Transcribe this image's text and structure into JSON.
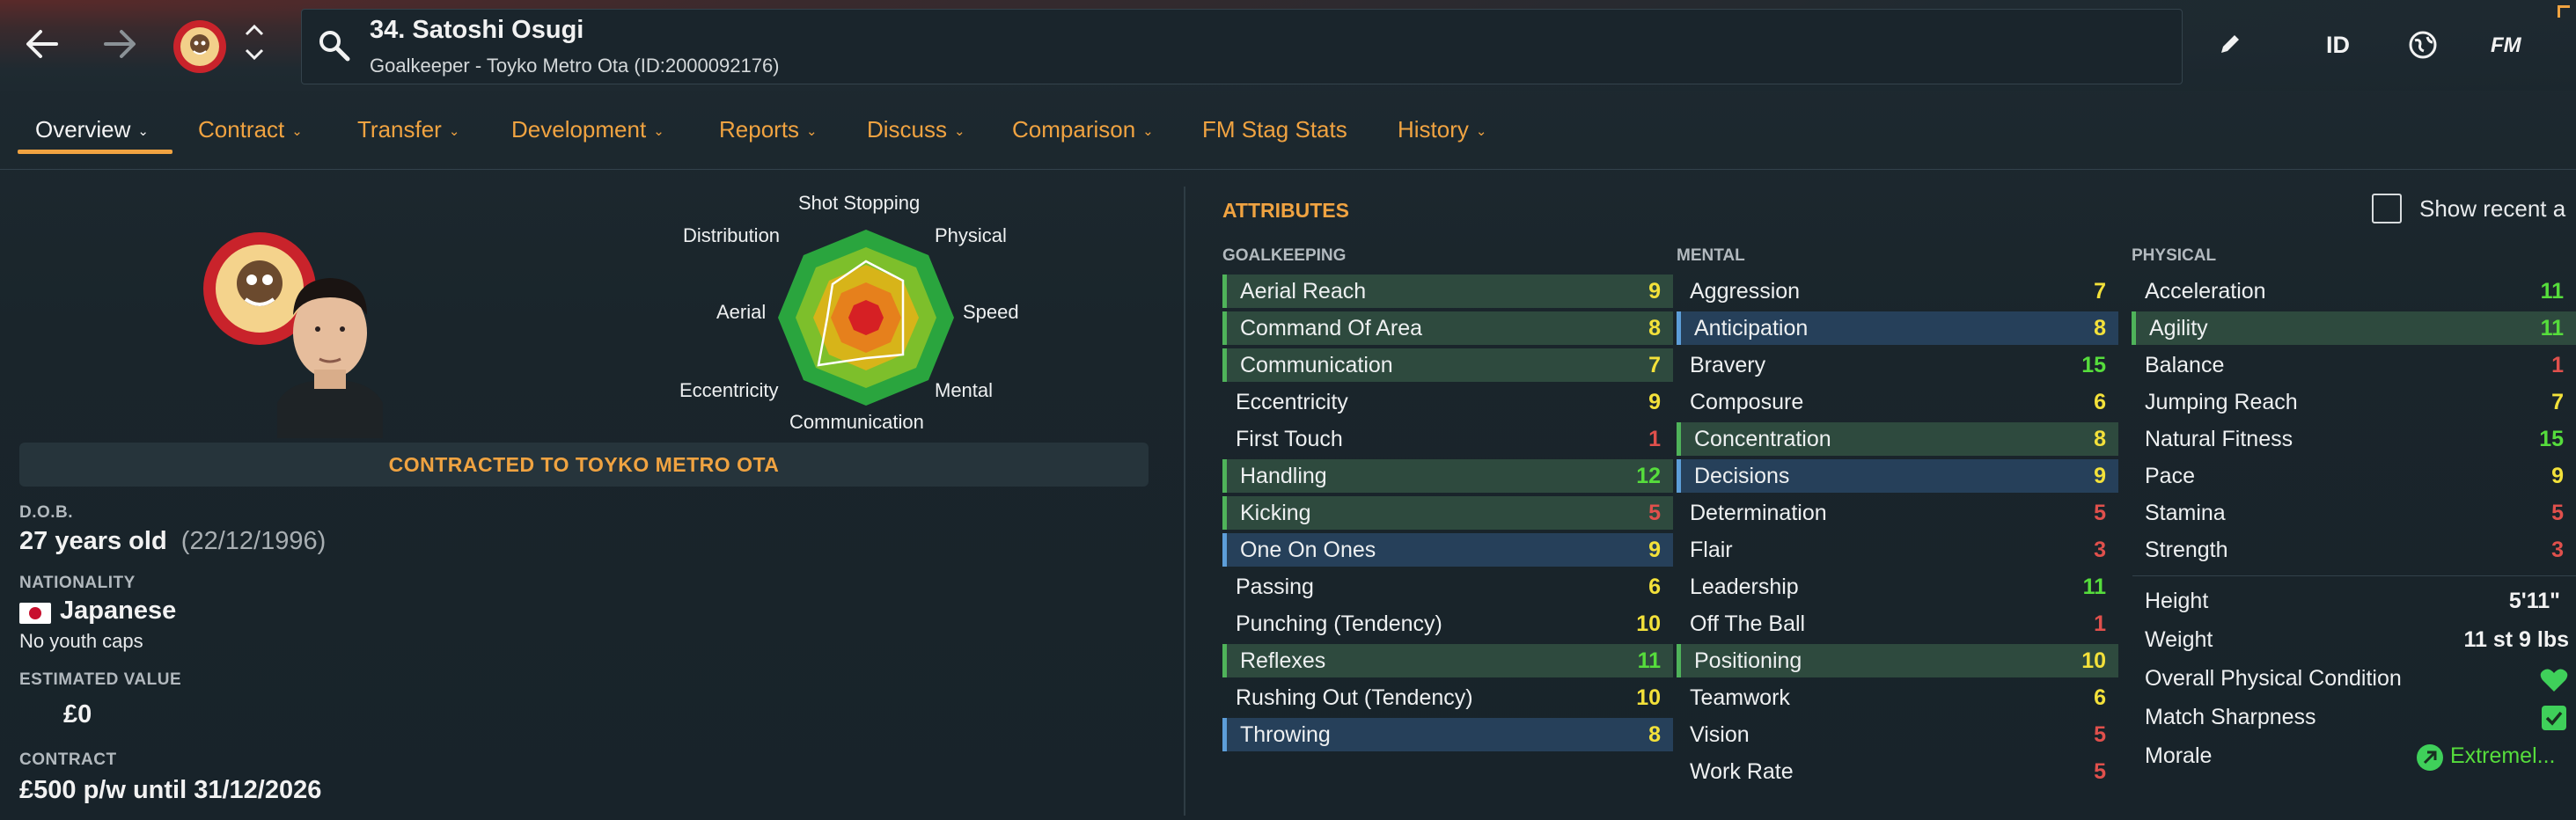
{
  "header": {
    "player_name": "34. Satoshi Osugi",
    "player_sub": "Goalkeeper - Toyko Metro Ota (ID:2000092176)",
    "id_label": "ID",
    "fm_label": "FM"
  },
  "tabs": [
    {
      "label": "Overview",
      "has_menu": true
    },
    {
      "label": "Contract",
      "has_menu": true
    },
    {
      "label": "Transfer",
      "has_menu": true
    },
    {
      "label": "Development",
      "has_menu": true
    },
    {
      "label": "Reports",
      "has_menu": true
    },
    {
      "label": "Discuss",
      "has_menu": true
    },
    {
      "label": "Comparison",
      "has_menu": true
    },
    {
      "label": "FM Stag Stats",
      "has_menu": false
    },
    {
      "label": "History",
      "has_menu": true
    }
  ],
  "radar": {
    "labels": [
      "Shot Stopping",
      "Physical",
      "Speed",
      "Mental",
      "Communication",
      "Eccentricity",
      "Aerial",
      "Distribution"
    ]
  },
  "profile": {
    "contract_banner": "CONTRACTED TO TOYKO METRO OTA",
    "dob_label": "D.O.B.",
    "age": "27 years old",
    "dob": "(22/12/1996)",
    "nationality_label": "NATIONALITY",
    "nationality": "Japanese",
    "youth_caps": "No youth caps",
    "value_label": "ESTIMATED VALUE",
    "value": "£0",
    "contract_label": "CONTRACT",
    "contract": "£500 p/w until 31/12/2026"
  },
  "attributes": {
    "title": "ATTRIBUTES",
    "show_recent": "Show recent a",
    "goalkeeping_label": "GOALKEEPING",
    "mental_label": "MENTAL",
    "physical_label": "PHYSICAL",
    "goalkeeping": [
      {
        "name": "Aerial Reach",
        "value": "9",
        "hl": "green"
      },
      {
        "name": "Command Of Area",
        "value": "8",
        "hl": "green"
      },
      {
        "name": "Communication",
        "value": "7",
        "hl": "green"
      },
      {
        "name": "Eccentricity",
        "value": "9",
        "hl": ""
      },
      {
        "name": "First Touch",
        "value": "1",
        "hl": ""
      },
      {
        "name": "Handling",
        "value": "12",
        "hl": "green"
      },
      {
        "name": "Kicking",
        "value": "5",
        "hl": "green"
      },
      {
        "name": "One On Ones",
        "value": "9",
        "hl": "blue"
      },
      {
        "name": "Passing",
        "value": "6",
        "hl": ""
      },
      {
        "name": "Punching (Tendency)",
        "value": "10",
        "hl": ""
      },
      {
        "name": "Reflexes",
        "value": "11",
        "hl": "green"
      },
      {
        "name": "Rushing Out (Tendency)",
        "value": "10",
        "hl": ""
      },
      {
        "name": "Throwing",
        "value": "8",
        "hl": "blue"
      }
    ],
    "mental": [
      {
        "name": "Aggression",
        "value": "7",
        "hl": ""
      },
      {
        "name": "Anticipation",
        "value": "8",
        "hl": "blue"
      },
      {
        "name": "Bravery",
        "value": "15",
        "hl": ""
      },
      {
        "name": "Composure",
        "value": "6",
        "hl": ""
      },
      {
        "name": "Concentration",
        "value": "8",
        "hl": "green"
      },
      {
        "name": "Decisions",
        "value": "9",
        "hl": "blue"
      },
      {
        "name": "Determination",
        "value": "5",
        "hl": ""
      },
      {
        "name": "Flair",
        "value": "3",
        "hl": ""
      },
      {
        "name": "Leadership",
        "value": "11",
        "hl": ""
      },
      {
        "name": "Off The Ball",
        "value": "1",
        "hl": ""
      },
      {
        "name": "Positioning",
        "value": "10",
        "hl": "green"
      },
      {
        "name": "Teamwork",
        "value": "6",
        "hl": ""
      },
      {
        "name": "Vision",
        "value": "5",
        "hl": ""
      },
      {
        "name": "Work Rate",
        "value": "5",
        "hl": ""
      }
    ],
    "physical": [
      {
        "name": "Acceleration",
        "value": "11",
        "hl": ""
      },
      {
        "name": "Agility",
        "value": "11",
        "hl": "green"
      },
      {
        "name": "Balance",
        "value": "1",
        "hl": ""
      },
      {
        "name": "Jumping Reach",
        "value": "7",
        "hl": ""
      },
      {
        "name": "Natural Fitness",
        "value": "15",
        "hl": ""
      },
      {
        "name": "Pace",
        "value": "9",
        "hl": ""
      },
      {
        "name": "Stamina",
        "value": "5",
        "hl": ""
      },
      {
        "name": "Strength",
        "value": "3",
        "hl": ""
      }
    ],
    "info": {
      "height_label": "Height",
      "height": "5'11\"",
      "weight_label": "Weight",
      "weight": "11 st 9 lbs",
      "condition_label": "Overall Physical Condition",
      "sharpness_label": "Match Sharpness",
      "morale_label": "Morale",
      "morale": "Extremel..."
    }
  },
  "colors": {
    "accent": "#f0a341",
    "value_low": "#e0504c",
    "value_mid": "#f3e13a",
    "value_high": "#56dd3c",
    "highlight_green": "#2e4a3e",
    "highlight_blue": "#26405a"
  }
}
